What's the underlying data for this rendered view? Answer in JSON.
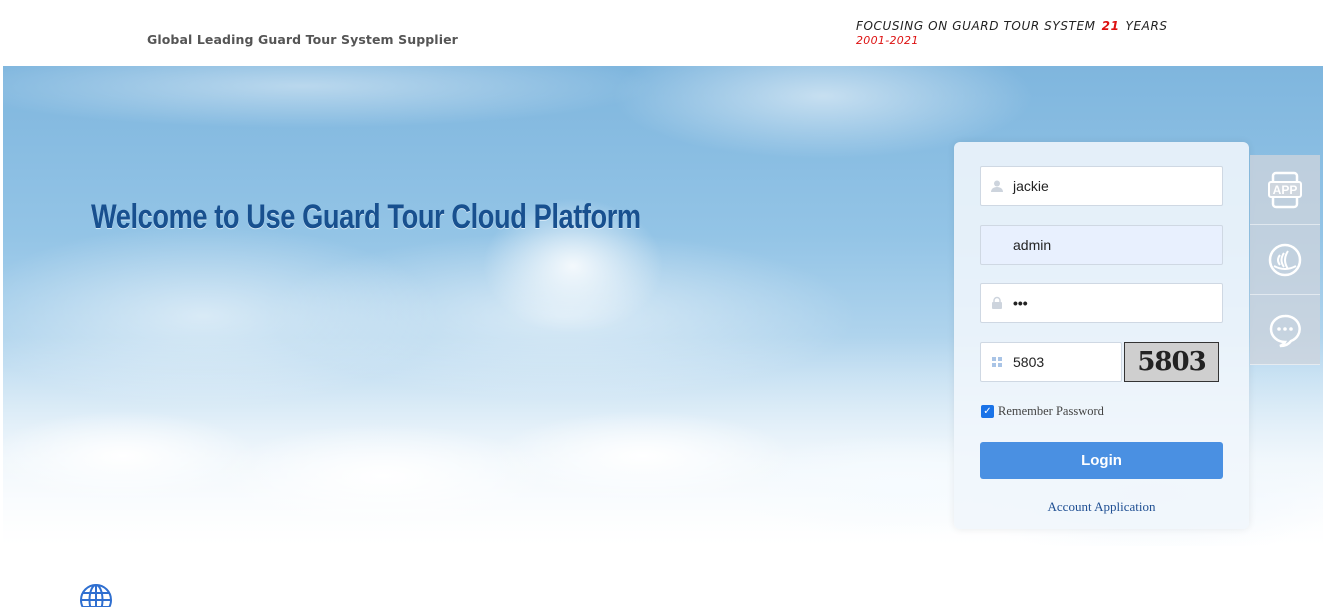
{
  "header": {
    "tagline": "Global Leading Guard Tour System Supplier",
    "focus_prefix": "FOCUSING ON GUARD TOUR SYSTEM",
    "focus_years_number": "21",
    "focus_suffix": "YEARS",
    "period": "2001-2021",
    "accent_color": "#dd1111"
  },
  "hero": {
    "welcome_text": "Welcome to Use Guard Tour Cloud Platform"
  },
  "login": {
    "username_value": "jackie",
    "username_icon": "user-icon",
    "company_value": "admin",
    "password_masked": "•••",
    "password_icon": "lock-icon",
    "captcha_input_value": "5803",
    "captcha_icon": "grid-icon",
    "captcha_image_text": "5803",
    "remember_label": "Remember Password",
    "remember_checked": true,
    "login_button": "Login",
    "account_link": "Account Application",
    "button_color": "#4a90e2"
  },
  "side_tools": [
    {
      "name": "app-icon",
      "label": "APP"
    },
    {
      "name": "nfc-icon"
    },
    {
      "name": "chat-icon"
    }
  ],
  "footer": {
    "icon": "globe-icon"
  }
}
